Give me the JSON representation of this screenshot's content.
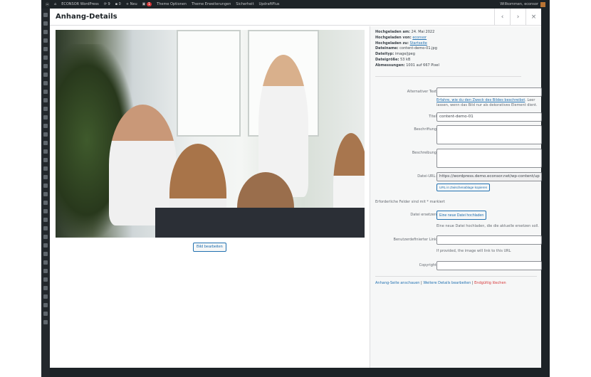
{
  "adminbar": {
    "site": "ECONSOR WordPress",
    "updates": "9",
    "comments": "0",
    "new": "Neu",
    "badge": "1",
    "items": [
      "Theme Optionen",
      "Theme Erweiterungen",
      "Sicherheit",
      "UpdraftPlus"
    ],
    "welcome": "Willkommen, econsor"
  },
  "modal": {
    "title": "Anhang-Details",
    "prev": "‹",
    "next": "›",
    "close": "×"
  },
  "image": {
    "edit_label": "Bild bearbeiten"
  },
  "meta": [
    {
      "label": "Hochgeladen am:",
      "value": "24. Mai 2022"
    },
    {
      "label": "Hochgeladen von:",
      "value": "econsor",
      "link": true
    },
    {
      "label": "Hochgeladen zu:",
      "value": "Startseite",
      "link": true
    },
    {
      "label": "Dateiname:",
      "value": "content-demo-01.jpg"
    },
    {
      "label": "Dateityp:",
      "value": "image/jpeg"
    },
    {
      "label": "Dateigröße:",
      "value": "53 kB"
    },
    {
      "label": "Abmessungen:",
      "value": "1001 auf 667 Pixel"
    }
  ],
  "fields": {
    "alt": {
      "label": "Alternativer Text",
      "value": "",
      "help_link": "Erfahre, wie du den Zweck des Bildes beschreibst",
      "help_rest": ". Leer lassen, wenn das Bild nur als dekoratives Element dient."
    },
    "title": {
      "label": "Titel",
      "value": "content-demo-01"
    },
    "caption": {
      "label": "Beschriftung",
      "value": ""
    },
    "description": {
      "label": "Beschreibung",
      "value": ""
    },
    "url": {
      "label": "Datei-URL:",
      "value": "https://wordpress.demo.econsor.net/wp-content/up",
      "copy": "URL in Zwischenablage kopieren"
    },
    "required_note": "Erforderliche Felder sind mit * markiert",
    "replace": {
      "label": "Datei ersetzen",
      "button": "Eine neue Datei hochladen",
      "help": "Eine neue Datei hochladen, die die aktuelle ersetzen soll."
    },
    "custom_link": {
      "label": "Benutzerdefinierter Link",
      "value": "",
      "help": "If provided, the image will link to this URL"
    },
    "copyright": {
      "label": "Copyright",
      "value": ""
    }
  },
  "actions": {
    "view": "Anhang-Seite anschauen",
    "sep": " | ",
    "edit": "Weitere Details bearbeiten",
    "delete": "Endgültig löschen"
  }
}
